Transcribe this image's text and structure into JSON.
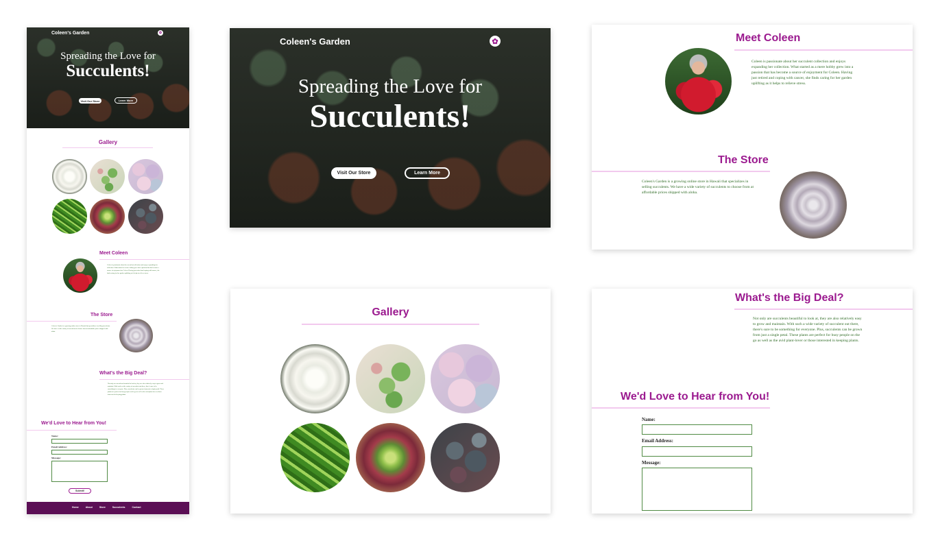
{
  "site": {
    "brand": "Coleen's Garden",
    "logo_icon": "lotus-icon"
  },
  "hero": {
    "line1": "Spreading the Love for",
    "line2": "Succulents!",
    "primary_button": "Visit Our Store",
    "secondary_button": "Learn More"
  },
  "gallery": {
    "title": "Gallery",
    "images": [
      "white-succulent",
      "string-succulent",
      "pastel-succulents",
      "spiral-succulent",
      "red-tipped-succulent",
      "dark-succulents"
    ]
  },
  "about": {
    "title": "Meet Coleen",
    "body": "Coleen is passionate about her succulent collection and enjoys expanding her collection. What started as a mere hobby grew into a passion that has become a source of enjoyment for Coleen. Having just retired and coping with cancer, she finds caring for her garden uplifting as it helps to relieve stress."
  },
  "store": {
    "title": "The Store",
    "body": "Coleen's Garden is a growing online store in Hawaii that specializes in selling succulents. We have a wide variety of succulents to choose from at affordable prices shipped with aloha."
  },
  "bigdeal": {
    "title": "What's the Big Deal?",
    "body": "Not only are succulents beautiful to look at, they are also relatively easy to grow and maintain. With such a wide variety of succulent out there, there's sure to be something for everyone. Plus, succulents can be grown from just a single petal. These plants are perfect for busy people on the go as well as the avid plant-lover or those interested in keeping plants."
  },
  "contact": {
    "title": "We'd Love to Hear from You!",
    "name_label": "Name:",
    "email_label": "Email Address:",
    "message_label": "Message:",
    "submit": "Submit!"
  },
  "footer": {
    "links": [
      "Home",
      "About",
      "Store",
      "Succulents",
      "Contact"
    ]
  },
  "colors": {
    "accent": "#9b1a8f",
    "text_green": "#2f6b25",
    "footer_bg": "#5b0f55",
    "rule": "#f2c9ee"
  }
}
